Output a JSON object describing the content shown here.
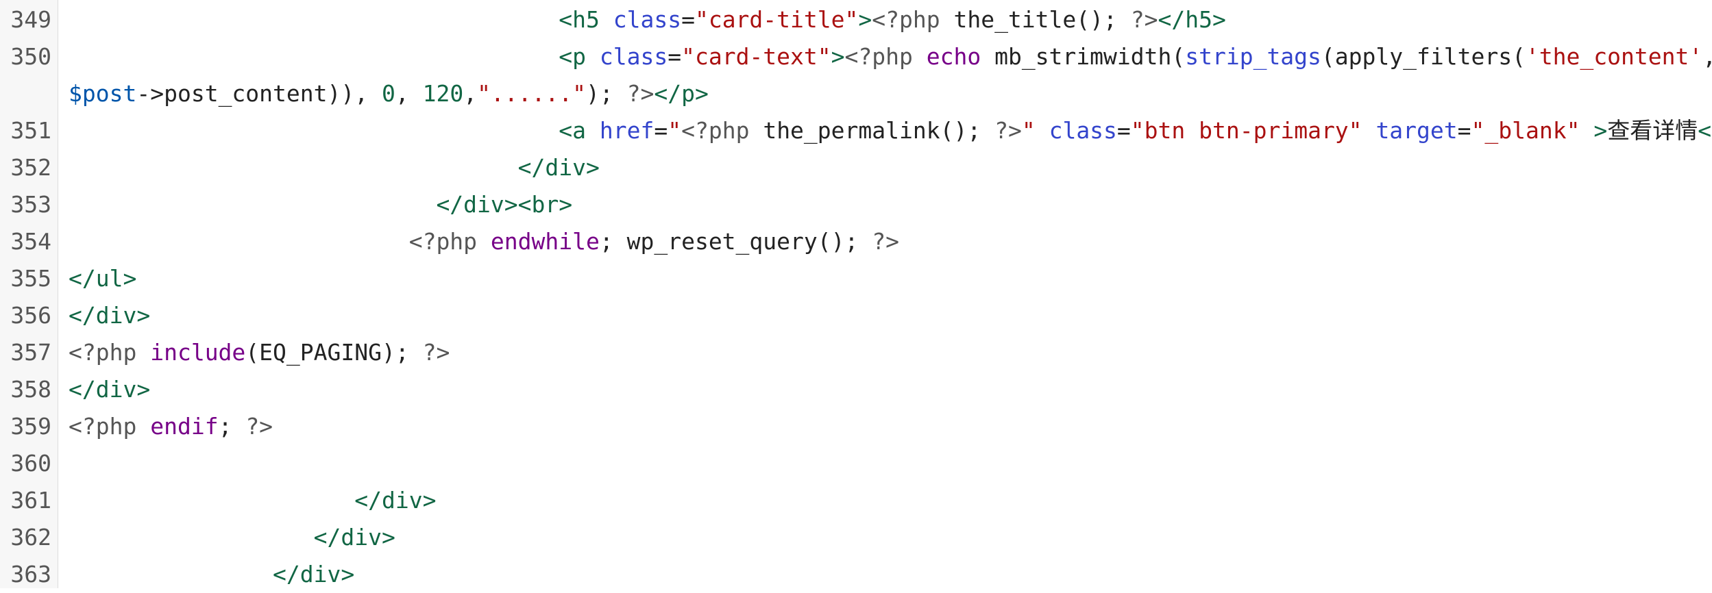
{
  "colors": {
    "background": "#ffffff",
    "gutter": "#f7f7f7",
    "gutter_border": "#dddddd",
    "line_number": "#555555",
    "plain": "#222222",
    "tag": "#116644",
    "attribute": "#3344cc",
    "string": "#aa1111",
    "keyword": "#770088",
    "variable": "#0055aa",
    "number": "#116644",
    "php_marker": "#555555"
  },
  "lines": [
    {
      "n": "349",
      "tokens": [
        {
          "t": "                                    ",
          "c": "plain"
        },
        {
          "t": "<h5",
          "c": "tag"
        },
        {
          "t": " ",
          "c": "plain"
        },
        {
          "t": "class",
          "c": "attr"
        },
        {
          "t": "=",
          "c": "plain"
        },
        {
          "t": "\"card-title\"",
          "c": "str"
        },
        {
          "t": ">",
          "c": "tag"
        },
        {
          "t": "<?php",
          "c": "meta"
        },
        {
          "t": " the_title(); ",
          "c": "plain"
        },
        {
          "t": "?>",
          "c": "meta"
        },
        {
          "t": "</h5>",
          "c": "tag"
        }
      ]
    },
    {
      "n": "350",
      "tokens": [
        {
          "t": "                                    ",
          "c": "plain"
        },
        {
          "t": "<p",
          "c": "tag"
        },
        {
          "t": " ",
          "c": "plain"
        },
        {
          "t": "class",
          "c": "attr"
        },
        {
          "t": "=",
          "c": "plain"
        },
        {
          "t": "\"card-text\"",
          "c": "str"
        },
        {
          "t": ">",
          "c": "tag"
        },
        {
          "t": "<?php",
          "c": "meta"
        },
        {
          "t": " ",
          "c": "plain"
        },
        {
          "t": "echo",
          "c": "kw"
        },
        {
          "t": " mb_strimwidth(",
          "c": "plain"
        },
        {
          "t": "strip_tags",
          "c": "attr"
        },
        {
          "t": "(apply_filters(",
          "c": "plain"
        },
        {
          "t": "'the_content'",
          "c": "str"
        },
        {
          "t": ",",
          "c": "plain"
        }
      ]
    },
    {
      "n": "",
      "tokens": [
        {
          "t": "$post",
          "c": "var"
        },
        {
          "t": "->",
          "c": "plain"
        },
        {
          "t": "post_content)), ",
          "c": "plain"
        },
        {
          "t": "0",
          "c": "num"
        },
        {
          "t": ", ",
          "c": "plain"
        },
        {
          "t": "120",
          "c": "num"
        },
        {
          "t": ",",
          "c": "plain"
        },
        {
          "t": "\"......\"",
          "c": "str"
        },
        {
          "t": "); ",
          "c": "plain"
        },
        {
          "t": "?>",
          "c": "meta"
        },
        {
          "t": "</p>",
          "c": "tag"
        }
      ]
    },
    {
      "n": "351",
      "tokens": [
        {
          "t": "                                    ",
          "c": "plain"
        },
        {
          "t": "<a",
          "c": "tag"
        },
        {
          "t": " ",
          "c": "plain"
        },
        {
          "t": "href",
          "c": "attr"
        },
        {
          "t": "=",
          "c": "plain"
        },
        {
          "t": "\"",
          "c": "str"
        },
        {
          "t": "<?php",
          "c": "meta"
        },
        {
          "t": " the_permalink(); ",
          "c": "plain"
        },
        {
          "t": "?>",
          "c": "meta"
        },
        {
          "t": "\"",
          "c": "str"
        },
        {
          "t": " ",
          "c": "plain"
        },
        {
          "t": "class",
          "c": "attr"
        },
        {
          "t": "=",
          "c": "plain"
        },
        {
          "t": "\"btn btn-primary\"",
          "c": "str"
        },
        {
          "t": " ",
          "c": "plain"
        },
        {
          "t": "target",
          "c": "attr"
        },
        {
          "t": "=",
          "c": "plain"
        },
        {
          "t": "\"_blank\"",
          "c": "str"
        },
        {
          "t": " ",
          "c": "plain"
        },
        {
          "t": ">",
          "c": "tag"
        },
        {
          "t": "查看详情",
          "c": "plain"
        },
        {
          "t": "</a>",
          "c": "tag"
        }
      ]
    },
    {
      "n": "352",
      "tokens": [
        {
          "t": "                                 ",
          "c": "plain"
        },
        {
          "t": "</div>",
          "c": "tag"
        }
      ]
    },
    {
      "n": "353",
      "tokens": [
        {
          "t": "                           ",
          "c": "plain"
        },
        {
          "t": "</div>",
          "c": "tag"
        },
        {
          "t": "<br>",
          "c": "tag"
        }
      ]
    },
    {
      "n": "354",
      "tokens": [
        {
          "t": "                         ",
          "c": "plain"
        },
        {
          "t": "<?php",
          "c": "meta"
        },
        {
          "t": " ",
          "c": "plain"
        },
        {
          "t": "endwhile",
          "c": "kw"
        },
        {
          "t": "; wp_reset_query(); ",
          "c": "plain"
        },
        {
          "t": "?>",
          "c": "meta"
        }
      ]
    },
    {
      "n": "355",
      "tokens": [
        {
          "t": "</ul>",
          "c": "tag"
        }
      ]
    },
    {
      "n": "356",
      "tokens": [
        {
          "t": "</div>",
          "c": "tag"
        }
      ]
    },
    {
      "n": "357",
      "tokens": [
        {
          "t": "<?php",
          "c": "meta"
        },
        {
          "t": " ",
          "c": "plain"
        },
        {
          "t": "include",
          "c": "kw"
        },
        {
          "t": "(EQ_PAGING); ",
          "c": "plain"
        },
        {
          "t": "?>",
          "c": "meta"
        }
      ]
    },
    {
      "n": "358",
      "tokens": [
        {
          "t": "</div>",
          "c": "tag"
        }
      ]
    },
    {
      "n": "359",
      "tokens": [
        {
          "t": "<?php",
          "c": "meta"
        },
        {
          "t": " ",
          "c": "plain"
        },
        {
          "t": "endif",
          "c": "kw"
        },
        {
          "t": "; ",
          "c": "plain"
        },
        {
          "t": "?>",
          "c": "meta"
        }
      ]
    },
    {
      "n": "360",
      "tokens": []
    },
    {
      "n": "361",
      "tokens": [
        {
          "t": "                     ",
          "c": "plain"
        },
        {
          "t": "</div>",
          "c": "tag"
        }
      ]
    },
    {
      "n": "362",
      "tokens": [
        {
          "t": "                  ",
          "c": "plain"
        },
        {
          "t": "</div>",
          "c": "tag"
        }
      ]
    },
    {
      "n": "363",
      "tokens": [
        {
          "t": "               ",
          "c": "plain"
        },
        {
          "t": "</div>",
          "c": "tag"
        }
      ]
    }
  ]
}
